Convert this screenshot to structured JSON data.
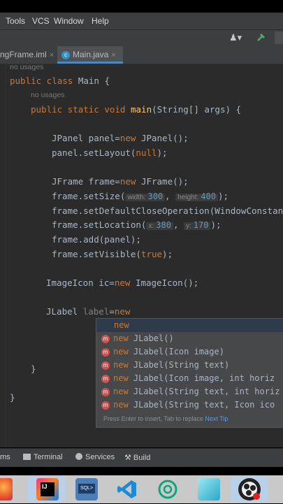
{
  "menu": {
    "items": [
      "Tools",
      "VCS",
      "Window",
      "Help"
    ]
  },
  "tabs": [
    {
      "label": "ngFrame.iml",
      "close": "×"
    },
    {
      "label": "Main.java",
      "close": "×"
    }
  ],
  "code": {
    "usage_top": "no usages",
    "class_decl": {
      "kw": "public class",
      "rest": " Main {"
    },
    "usage_main": "no usages",
    "main_decl": {
      "kw": "public static void ",
      "fn": "main",
      "rest": "(String[] args) {"
    },
    "panel_decl": {
      "a": "JPanel panel=",
      "kw": "new",
      "b": " JPanel();"
    },
    "set_layout": {
      "a": "panel.setLayout(",
      "kw": "null",
      "b": ");"
    },
    "frame_decl": {
      "a": "JFrame frame=",
      "kw": "new",
      "b": " JFrame();"
    },
    "set_size": {
      "a": "frame.setSize(",
      "h1": "width:",
      "v1": "300",
      "sep": ",",
      "h2": "height:",
      "v2": "400",
      "b": ");"
    },
    "set_close": "frame.setDefaultCloseOperation(WindowConstant",
    "set_location": {
      "a": "frame.setLocation(",
      "h1": "x:",
      "v1": "380",
      "sep": ",",
      "h2": "y:",
      "v2": "170",
      "b": ");"
    },
    "add_panel": "frame.add(panel);",
    "set_visible": {
      "a": "frame.setVisible(",
      "kw": "true",
      "b": ");"
    },
    "imageicon": {
      "a": "ImageIcon ic=",
      "kw": "new",
      "b": " ImageIcon();"
    },
    "jlabel": {
      "a": "JLabel ",
      "var": "label",
      "eq": "=",
      "kw": "new"
    },
    "close_method": "}",
    "close_class": "}"
  },
  "completion": {
    "first": "new",
    "items": [
      {
        "kw": "new",
        "text": " JLabel()"
      },
      {
        "kw": "new",
        "text": " JLabel(Icon image)"
      },
      {
        "kw": "new",
        "text": " JLabel(String text)"
      },
      {
        "kw": "new",
        "text": " JLabel(Icon image, int horiz"
      },
      {
        "kw": "new",
        "text": " JLabel(String text, int horiz"
      },
      {
        "kw": "new",
        "text": " JLabel(String text, Icon ico"
      }
    ],
    "badge": "m",
    "footer": "Press Enter to insert, Tab to replace",
    "next_tip": "Next Tip"
  },
  "bottom_bar": {
    "problems": "ms",
    "terminal": "Terminal",
    "services": "Services",
    "build": "Build"
  },
  "colors": {
    "editor_bg": "#2b2b2b",
    "keyword": "#cc7832",
    "function": "#ffc66d",
    "number": "#6897bb",
    "accent": "#4a88c7"
  }
}
